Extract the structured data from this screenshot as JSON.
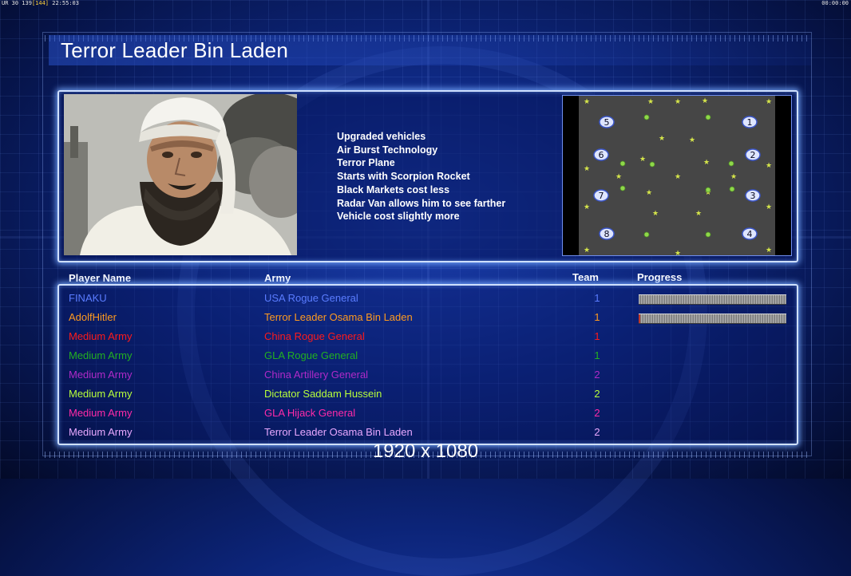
{
  "hud": {
    "left_label": "UR",
    "left_stats": "30 139",
    "left_highlight": "[144]",
    "left_time": "22:55:03",
    "right_time": "00:00:00"
  },
  "title": "Terror Leader Bin Laden",
  "traits": [
    "Upgraded vehicles",
    "Air Burst Technology",
    "Terror Plane",
    "Starts with Scorpion Rocket",
    "Black Markets cost less",
    "Radar Van allows him to see farther",
    "Vehicle cost slightly more"
  ],
  "map": {
    "start_positions": [
      "1",
      "2",
      "3",
      "4",
      "5",
      "6",
      "7",
      "8"
    ]
  },
  "table": {
    "headers": {
      "player": "Player Name",
      "army": "Army",
      "team": "Team",
      "progress": "Progress"
    },
    "rows": [
      {
        "name": "FINAKU",
        "army": "USA Rogue General",
        "team": "1",
        "color": "#5a7cff",
        "progress": 0.0
      },
      {
        "name": "AdolfHitler",
        "army": "Terror Leader Osama Bin Laden",
        "team": "1",
        "color": "#ff9a1f",
        "progress": 0.01
      },
      {
        "name": "Medium Army",
        "army": "China Rogue General",
        "team": "1",
        "color": "#ff1a1a"
      },
      {
        "name": "Medium Army",
        "army": "GLA Rogue General",
        "team": "1",
        "color": "#22b020"
      },
      {
        "name": "Medium Army",
        "army": "China Artillery General",
        "team": "2",
        "color": "#b02ac8"
      },
      {
        "name": "Medium Army",
        "army": "Dictator Saddam Hussein",
        "team": "2",
        "color": "#b8ff3a"
      },
      {
        "name": "Medium Army",
        "army": "GLA Hijack General",
        "team": "2",
        "color": "#ff2aa8"
      },
      {
        "name": "Medium Army",
        "army": "Terror Leader Osama Bin Laden",
        "team": "2",
        "color": "#e8a8ff"
      }
    ]
  },
  "resolution": "1920 x 1080"
}
